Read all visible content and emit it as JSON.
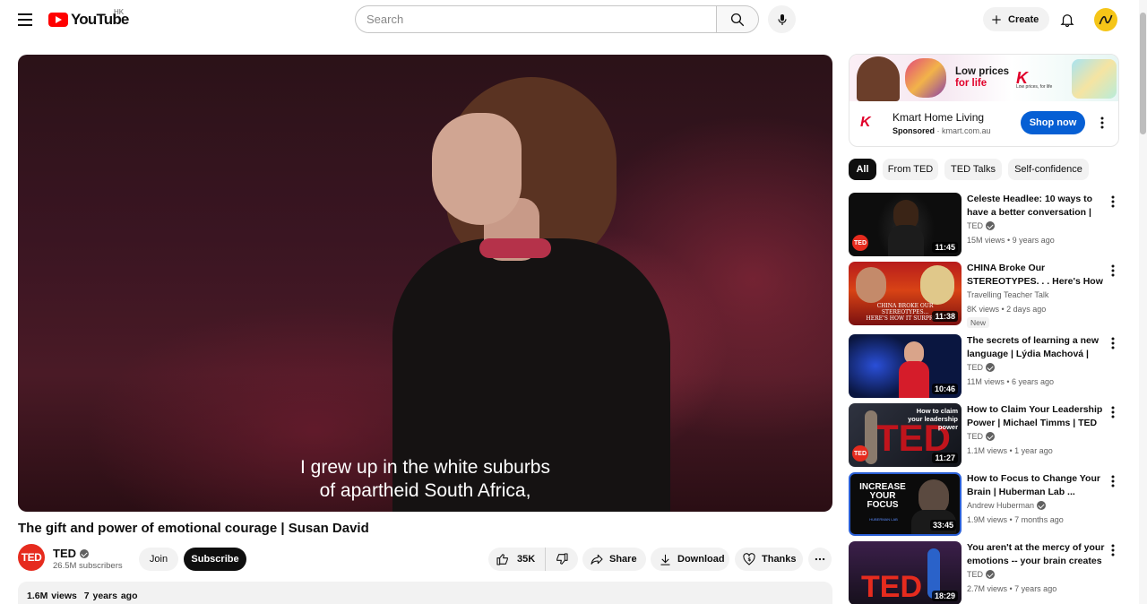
{
  "header": {
    "logo_text": "YouTube",
    "region": "HK",
    "search_placeholder": "Search",
    "create_label": "Create"
  },
  "player": {
    "subtitle_line1": "I grew up in the white suburbs",
    "subtitle_line2": "of apartheid South Africa,"
  },
  "video": {
    "title": "The gift and power of emotional courage | Susan David",
    "channel_avatar_text": "TED",
    "channel_name": "TED",
    "subscribers": "26.5M subscribers",
    "join_label": "Join",
    "subscribe_label": "Subscribe",
    "likes": "35K",
    "share_label": "Share",
    "download_label": "Download",
    "thanks_label": "Thanks",
    "views": "1.6M views",
    "age": "7 years ago"
  },
  "ad": {
    "banner_line1": "Low prices",
    "banner_line2": "for life",
    "banner_brand": "K",
    "banner_tagline": "Low prices, for life",
    "logo": "K",
    "title": "Kmart Home Living",
    "sponsored": "Sponsored",
    "domain": "kmart.com.au",
    "cta": "Shop now"
  },
  "chips": [
    "All",
    "From TED",
    "TED Talks",
    "Self-confidence"
  ],
  "recommendations": [
    {
      "title": "Celeste Headlee: 10 ways to have a better conversation | TED",
      "channel": "TED",
      "verified": true,
      "views": "15M views",
      "age": "9 years ago",
      "duration": "11:45",
      "badge": ""
    },
    {
      "title": "CHINA Broke Our STEREOTYPES. . . Here's How ...",
      "channel": "Travelling Teacher Talk",
      "verified": false,
      "views": "8K views",
      "age": "2 days ago",
      "duration": "11:38",
      "badge": "New"
    },
    {
      "title": "The secrets of learning a new language | Lýdia Machová | TED",
      "channel": "TED",
      "verified": true,
      "views": "11M views",
      "age": "6 years ago",
      "duration": "10:46",
      "badge": ""
    },
    {
      "title": "How to Claim Your Leadership Power | Michael Timms | TED",
      "channel": "TED",
      "verified": true,
      "views": "1.1M views",
      "age": "1 year ago",
      "duration": "11:27",
      "badge": ""
    },
    {
      "title": "How to Focus to Change Your Brain | Huberman Lab ...",
      "channel": "Andrew Huberman",
      "verified": true,
      "views": "1.9M views",
      "age": "7 months ago",
      "duration": "33:45",
      "badge": ""
    },
    {
      "title": "You aren't at the mercy of your emotions -- your brain creates ...",
      "channel": "TED",
      "verified": true,
      "views": "2.7M views",
      "age": "7 years ago",
      "duration": "18:29",
      "badge": ""
    }
  ],
  "thumb_text": {
    "ted_badge": "TED",
    "china_caption_1": "CHINA BROKE OUR",
    "china_caption_2": "STEREOTYPES...",
    "china_caption_3": "HERE'S HOW IT SURPRIS...",
    "leadership_1": "How to claim",
    "leadership_2": "your leadership",
    "leadership_3": "power",
    "leadership_bg": "TED",
    "focus_1": "INCREASE",
    "focus_2": "YOUR",
    "focus_3": "FOCUS",
    "focus_sub": "HUBERMAN LAB",
    "emotions_bg": "TED"
  }
}
